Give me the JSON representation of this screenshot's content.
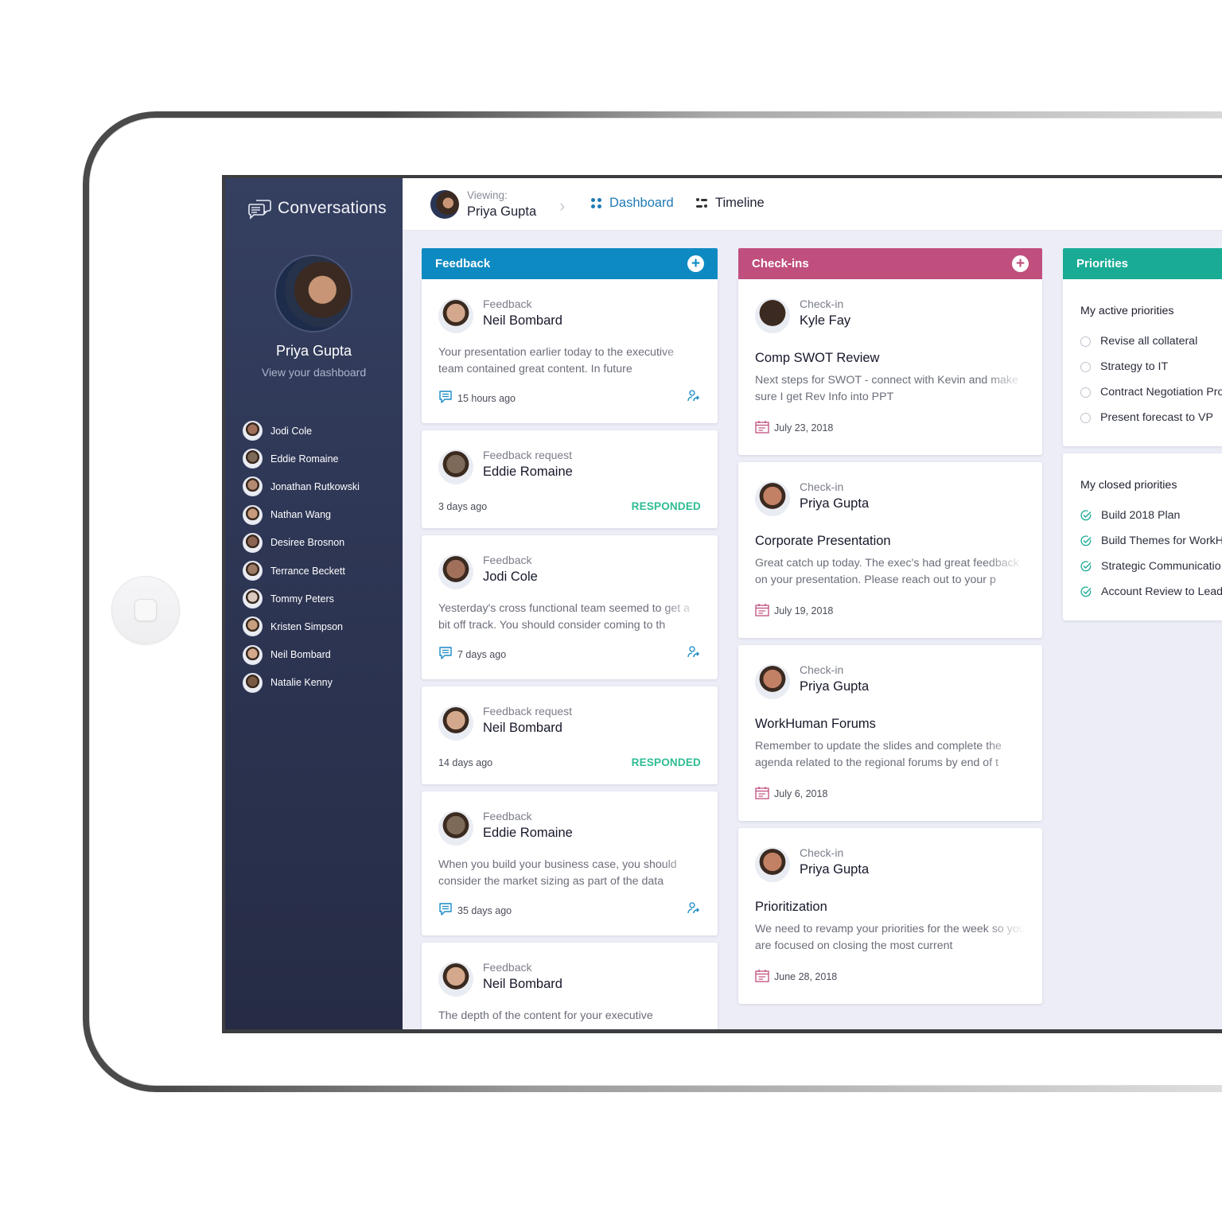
{
  "app": {
    "title": "Conversations",
    "icons": {
      "brand": "chat-bubbles-icon"
    }
  },
  "colors": {
    "sidebar_bg": "#313a5a",
    "feedback_header": "#0e8ac2",
    "checkins_header": "#c04f7e",
    "priorities_header": "#1aab95",
    "responded": "#2ebc94",
    "active_tab": "#1f7ab5"
  },
  "profile": {
    "name": "Priya Gupta",
    "subtitle": "View your dashboard"
  },
  "people": [
    {
      "name": "Jodi Cole",
      "color": "#a0705a"
    },
    {
      "name": "Eddie Romaine",
      "color": "#7d6a58"
    },
    {
      "name": "Jonathan Rutkowski",
      "color": "#b58a72"
    },
    {
      "name": "Nathan Wang",
      "color": "#c79a7d"
    },
    {
      "name": "Desiree Brosnon",
      "color": "#8b6452"
    },
    {
      "name": "Terrance Beckett",
      "color": "#9c7c66"
    },
    {
      "name": "Tommy Peters",
      "color": "#d9c9bf"
    },
    {
      "name": "Kristen Simpson",
      "color": "#c8a080"
    },
    {
      "name": "Neil Bombard",
      "color": "#d3a88c"
    },
    {
      "name": "Natalie Kenny",
      "color": "#7a5a44"
    }
  ],
  "topbar": {
    "viewing_label": "Viewing:",
    "viewing_name": "Priya Gupta",
    "tabs": [
      {
        "label": "Dashboard",
        "active": true,
        "icon": "dashboard-grid-icon"
      },
      {
        "label": "Timeline",
        "active": false,
        "icon": "timeline-icon"
      }
    ]
  },
  "feedback": {
    "title": "Feedback",
    "items": [
      {
        "type": "Feedback",
        "name": "Neil Bombard",
        "body": "Your presentation earlier today to the executive team contained great content.  In future",
        "time": "15 hours ago",
        "avatar": "#d3a88c"
      },
      {
        "type": "Feedback request",
        "name": "Eddie Romaine",
        "time": "3 days ago",
        "status": "RESPONDED",
        "avatar": "#7d6a58"
      },
      {
        "type": "Feedback",
        "name": "Jodi Cole",
        "body": "Yesterday's cross functional team seemed to get a bit off track.  You should consider coming to th",
        "time": "7 days ago",
        "avatar": "#a0705a"
      },
      {
        "type": "Feedback request",
        "name": "Neil Bombard",
        "time": "14 days ago",
        "status": "RESPONDED",
        "avatar": "#d3a88c"
      },
      {
        "type": "Feedback",
        "name": "Eddie Romaine",
        "body": "When you build your business case, you should consider the market sizing as part of the data",
        "time": "35 days ago",
        "avatar": "#7d6a58"
      },
      {
        "type": "Feedback",
        "name": "Neil Bombard",
        "body": "The depth of the content for your executive",
        "avatar": "#d3a88c"
      }
    ]
  },
  "checkins": {
    "title": "Check-ins",
    "items": [
      {
        "type": "Check-in",
        "name": "Kyle Fay",
        "title": "Comp SWOT Review",
        "body": "Next steps for SWOT - connect with Kevin and make sure I get Rev Info into PPT",
        "date": "July 23, 2018",
        "avatar": "#3a2a22"
      },
      {
        "type": "Check-in",
        "name": "Priya Gupta",
        "title": "Corporate Presentation",
        "body": "Great catch up today.  The exec's had great feedback on your presentation.  Please reach out to your p",
        "date": "July 19, 2018",
        "avatar": "#c28064"
      },
      {
        "type": "Check-in",
        "name": "Priya Gupta",
        "title": "WorkHuman Forums",
        "body": "Remember to update the slides and complete the agenda related to the regional forums by end of t",
        "date": "July 6, 2018",
        "avatar": "#c28064"
      },
      {
        "type": "Check-in",
        "name": "Priya Gupta",
        "title": "Prioritization",
        "body": "We need to revamp your priorities for the week so you are focused on closing the most current",
        "date": "June 28, 2018",
        "avatar": "#c28064"
      }
    ]
  },
  "priorities": {
    "title": "Priorities",
    "active_heading": "My active priorities",
    "active": [
      "Revise all collateral",
      "Strategy to IT",
      "Contract Negotiation Pro",
      "Present forecast to VP"
    ],
    "closed_heading": "My closed priorities",
    "closed": [
      "Build 2018 Plan",
      "Build Themes for WorkH",
      "Strategic Communicatio",
      "Account Review to Lead"
    ]
  }
}
